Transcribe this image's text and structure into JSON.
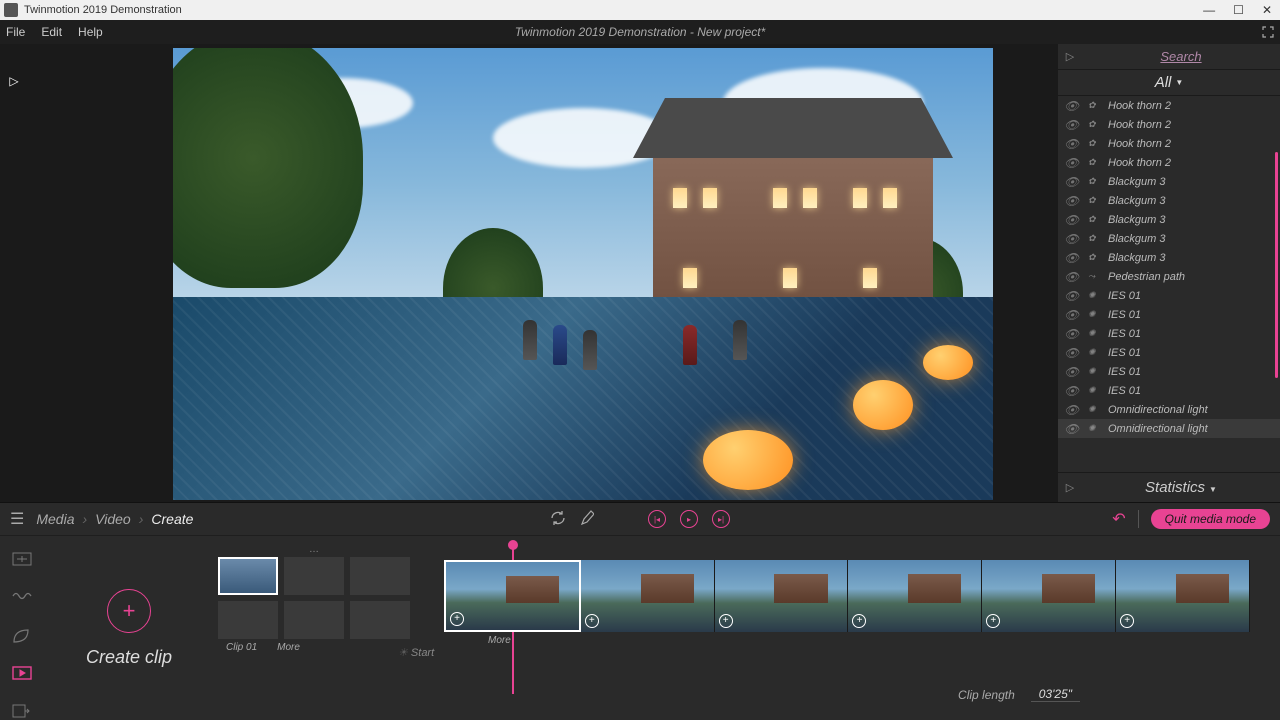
{
  "titlebar": {
    "title": "Twinmotion 2019 Demonstration"
  },
  "menubar": {
    "items": [
      "File",
      "Edit",
      "Help"
    ],
    "doc_title": "Twinmotion 2019 Demonstration - New project*"
  },
  "right_panel": {
    "search_label": "Search",
    "filter_label": "All",
    "stats_label": "Statistics",
    "items": [
      {
        "icon": "branch",
        "label": "Hook thorn 2"
      },
      {
        "icon": "branch",
        "label": "Hook thorn 2"
      },
      {
        "icon": "branch",
        "label": "Hook thorn 2"
      },
      {
        "icon": "branch",
        "label": "Hook thorn 2"
      },
      {
        "icon": "branch",
        "label": "Blackgum 3"
      },
      {
        "icon": "branch",
        "label": "Blackgum 3"
      },
      {
        "icon": "branch",
        "label": "Blackgum 3"
      },
      {
        "icon": "branch",
        "label": "Blackgum 3"
      },
      {
        "icon": "branch",
        "label": "Blackgum 3"
      },
      {
        "icon": "path",
        "label": "Pedestrian path"
      },
      {
        "icon": "light",
        "label": "IES 01"
      },
      {
        "icon": "light",
        "label": "IES 01"
      },
      {
        "icon": "light",
        "label": "IES 01"
      },
      {
        "icon": "light",
        "label": "IES 01"
      },
      {
        "icon": "light",
        "label": "IES 01"
      },
      {
        "icon": "light",
        "label": "IES 01"
      },
      {
        "icon": "light",
        "label": "Omnidirectional light"
      },
      {
        "icon": "light",
        "label": "Omnidirectional light",
        "hl": true
      }
    ]
  },
  "dock": {
    "breadcrumb": [
      "Media",
      "Video",
      "Create"
    ],
    "quit_label": "Quit media mode",
    "create_label": "Create clip",
    "clip1_label": "Clip 01",
    "more_label": "More",
    "strip_more": "More",
    "start_label": "Start",
    "clip_length_label": "Clip length",
    "clip_length_value": "03'25\""
  }
}
